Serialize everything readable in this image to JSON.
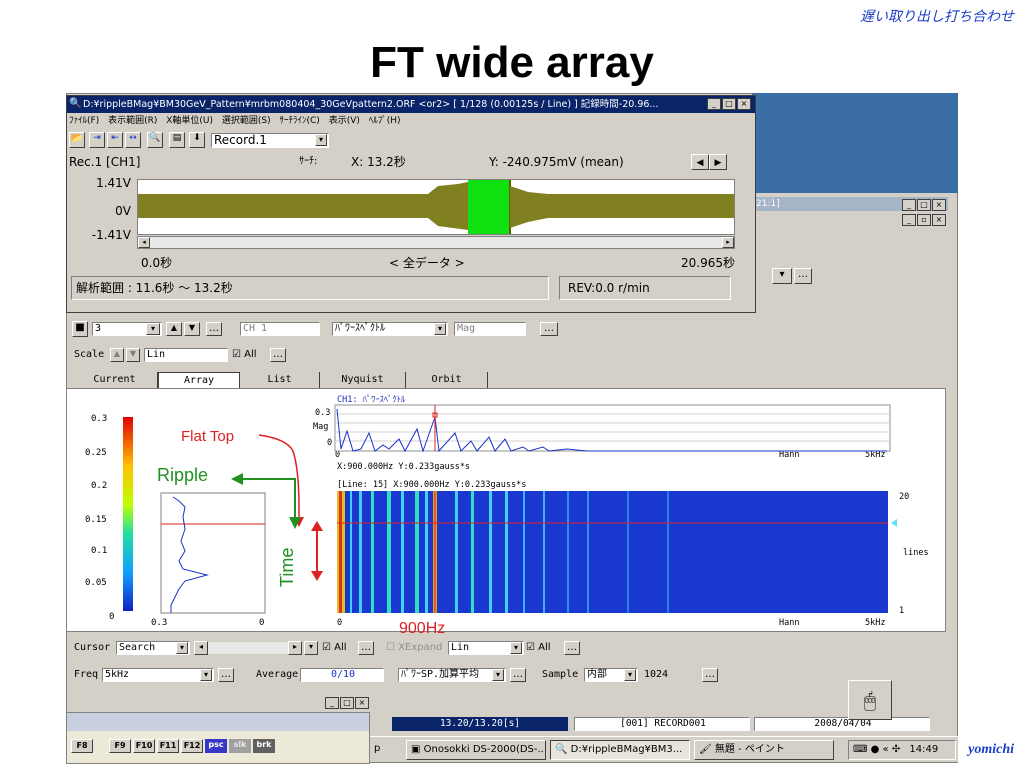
{
  "slide": {
    "note": "遅い取り出し打ち合わせ",
    "title": "FT wide array",
    "footer": "yomichi"
  },
  "overlay_window": {
    "title": "D:¥rippleBMag¥BM30GeV_Pattern¥mrbm080404_30GeVpattern2.ORF <or2> [ 1/128 (0.00125s / Line) ] 記録時間-20.96...",
    "menu": [
      "ﾌｧｲﾙ(F)",
      "表示範囲(R)",
      "X軸単位(U)",
      "選択範囲(S)",
      "ｻｰﾁﾗｲﾝ(C)",
      "表示(V)",
      "ﾍﾙﾌﾟ(H)"
    ],
    "record_select": "Record.1",
    "rec_label": "Rec.1 [CH1]",
    "search_label": "ｻｰﾁ:",
    "x_readout": "X: 13.2秒",
    "y_readout": "Y: -240.975mV (mean)",
    "y_ticks": [
      "1.41V",
      "0V",
      "-1.41V"
    ],
    "time_start": "0.0秒",
    "time_mid": "< 全データ >",
    "time_end": "20.965秒",
    "range_text": "解析範囲 : 11.6秒 ～ 13.2秒",
    "rev_text": "REV:0.0 r/min"
  },
  "toolbar1": {
    "num": "3",
    "ch": "CH 1",
    "type": "ﾊﾟﾜｰｽﾍﾟｸﾄﾙ",
    "mag": "Mag"
  },
  "toolbar2": {
    "scale_label": "Scale",
    "scale_value": "Lin",
    "all_label": "All"
  },
  "tabs": [
    "Current",
    "Array",
    "List",
    "Nyquist",
    "Orbit"
  ],
  "colorbar": {
    "ticks": [
      "0.3",
      "0.25",
      "0.2",
      "0.15",
      "0.1",
      "0.05",
      "0"
    ],
    "x_ticks": [
      "0.3",
      "0"
    ]
  },
  "spectrum": {
    "title": "CH1: ﾊﾟﾜｰｽﾍﾟｸﾄﾙ",
    "y_top": "0.3",
    "y_label": "Mag",
    "y_bottom": "0",
    "x_start": "0",
    "window": "Hann",
    "x_end": "5kHz",
    "readout": "X:900.000Hz Y:0.233gauss*s"
  },
  "array": {
    "header": "[Line: 15]   X:900.000Hz Y:0.233gauss*s",
    "lines_top": "20",
    "lines_label": "lines",
    "lines_bottom": "1",
    "x_start": "0",
    "window": "Hann",
    "x_end": "5kHz"
  },
  "annotations": {
    "flat_top": "Flat Top",
    "ripple": "Ripple",
    "time": "Time",
    "freq": "900Hz"
  },
  "cursor_bar": {
    "label": "Cursor",
    "mode": "Search",
    "all1": "All",
    "xexpand": "XExpand",
    "lin": "Lin",
    "all2": "All"
  },
  "freq_bar": {
    "freq_label": "Freq",
    "freq_value": "5kHz",
    "average_label": "Average",
    "average_value": "0/10",
    "avg_mode": "ﾊﾟﾜｰSP.加算平均",
    "sample_label": "Sample",
    "sample_value": "内部",
    "sample_count": "1024"
  },
  "status": {
    "time": "13.20/13.20[s]",
    "record": "[001] RECORD001",
    "date": "2008/04/04"
  },
  "fkeys": [
    "F8",
    "F9",
    "F10",
    "F11",
    "F12",
    "psc",
    "slk",
    "brk"
  ],
  "taskbar": {
    "item1": "p",
    "item2": "Onosokki DS-2000(DS-...",
    "item3": "D:¥rippleBMag¥BM3...",
    "item4": "無題 - ペイント",
    "clock": "14:49"
  },
  "bg_window": {
    "title_fragment": "21:1]"
  }
}
